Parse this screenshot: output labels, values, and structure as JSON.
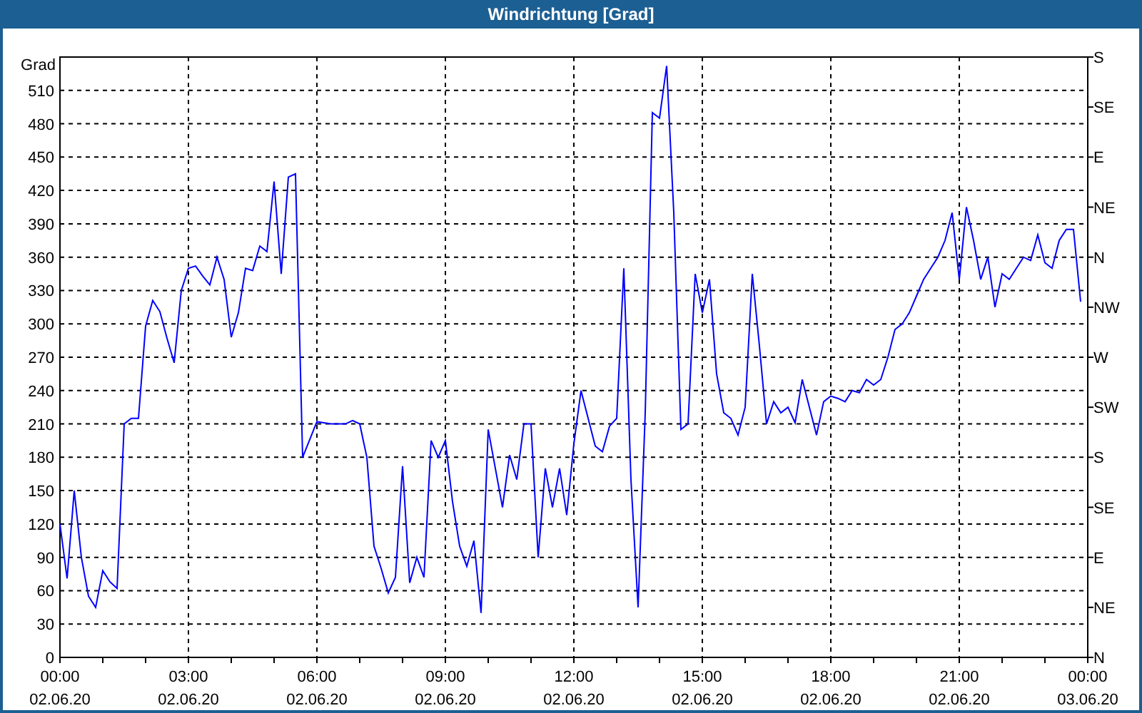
{
  "window": {
    "title": "Windrichtung [Grad]"
  },
  "chart_data": {
    "type": "line",
    "grid": true,
    "ylabel": "Grad",
    "ylim": [
      0,
      540
    ],
    "categories": [
      "00:00\n02.06.20",
      null,
      null,
      null,
      null,
      null,
      null,
      null,
      null,
      null,
      null,
      null,
      null,
      null,
      null,
      null,
      null,
      null,
      "03:00\n02.06.20",
      null,
      null,
      null,
      null,
      null,
      null,
      null,
      null,
      null,
      null,
      null,
      null,
      null,
      null,
      null,
      null,
      null,
      "06:00\n02.06.20",
      null,
      null,
      null,
      null,
      null,
      null,
      null,
      null,
      null,
      null,
      null,
      null,
      null,
      null,
      null,
      null,
      null,
      "09:00\n02.06.20",
      null,
      null,
      null,
      null,
      null,
      null,
      null,
      null,
      null,
      null,
      null,
      null,
      null,
      null,
      null,
      null,
      null,
      "12:00\n02.06.20",
      null,
      null,
      null,
      null,
      null,
      null,
      null,
      null,
      null,
      null,
      null,
      null,
      null,
      null,
      null,
      null,
      null,
      "15:00\n02.06.20",
      null,
      null,
      null,
      null,
      null,
      null,
      null,
      null,
      null,
      null,
      null,
      null,
      null,
      null,
      null,
      null,
      null,
      "18:00\n02.06.20",
      null,
      null,
      null,
      null,
      null,
      null,
      null,
      null,
      null,
      null,
      null,
      null,
      null,
      null,
      null,
      null,
      null,
      "21:00\n02.06.20",
      null,
      null,
      null,
      null,
      null,
      null,
      null,
      null,
      null,
      null,
      null,
      null,
      null,
      null,
      null,
      null,
      null,
      "00:00\n03.06.20"
    ],
    "series": [
      {
        "color": "#0000ff",
        "values": [
          120,
          71,
          150,
          90,
          55,
          45,
          78,
          68,
          62,
          210,
          215,
          215,
          298,
          321,
          311,
          287,
          265,
          330,
          350,
          352,
          343,
          335,
          360,
          340,
          288,
          310,
          350,
          348,
          370,
          365,
          428,
          345,
          432,
          435,
          180,
          196,
          212,
          211,
          210,
          210,
          210,
          213,
          210,
          180,
          100,
          80,
          58,
          72,
          172,
          67,
          90,
          72,
          195,
          180,
          195,
          140,
          100,
          82,
          105,
          40,
          205,
          170,
          135,
          182,
          160,
          210,
          210,
          90,
          170,
          135,
          170,
          128,
          192,
          240,
          215,
          190,
          185,
          208,
          215,
          350,
          160,
          45,
          220,
          490,
          485,
          532,
          400,
          205,
          210,
          345,
          310,
          340,
          255,
          220,
          215,
          200,
          225,
          345,
          280,
          210,
          230,
          220,
          225,
          211,
          250,
          225,
          200,
          230,
          235,
          233,
          230,
          240,
          238,
          250,
          245,
          250,
          270,
          295,
          300,
          310,
          325,
          340,
          350,
          360,
          375,
          400,
          340,
          405,
          375,
          340,
          360,
          315,
          345,
          340,
          350,
          360,
          357,
          380,
          355,
          350,
          375,
          385,
          385,
          320,
          null
        ]
      }
    ],
    "yticks": [
      0,
      30,
      60,
      90,
      120,
      150,
      180,
      210,
      240,
      270,
      300,
      330,
      360,
      390,
      420,
      450,
      480,
      510
    ]
  },
  "compass_axis": {
    "labels": [
      "S",
      "SE",
      "E",
      "NE",
      "N",
      "NW",
      "W",
      "SW",
      "S",
      "SE",
      "E",
      "NE",
      "N"
    ]
  }
}
